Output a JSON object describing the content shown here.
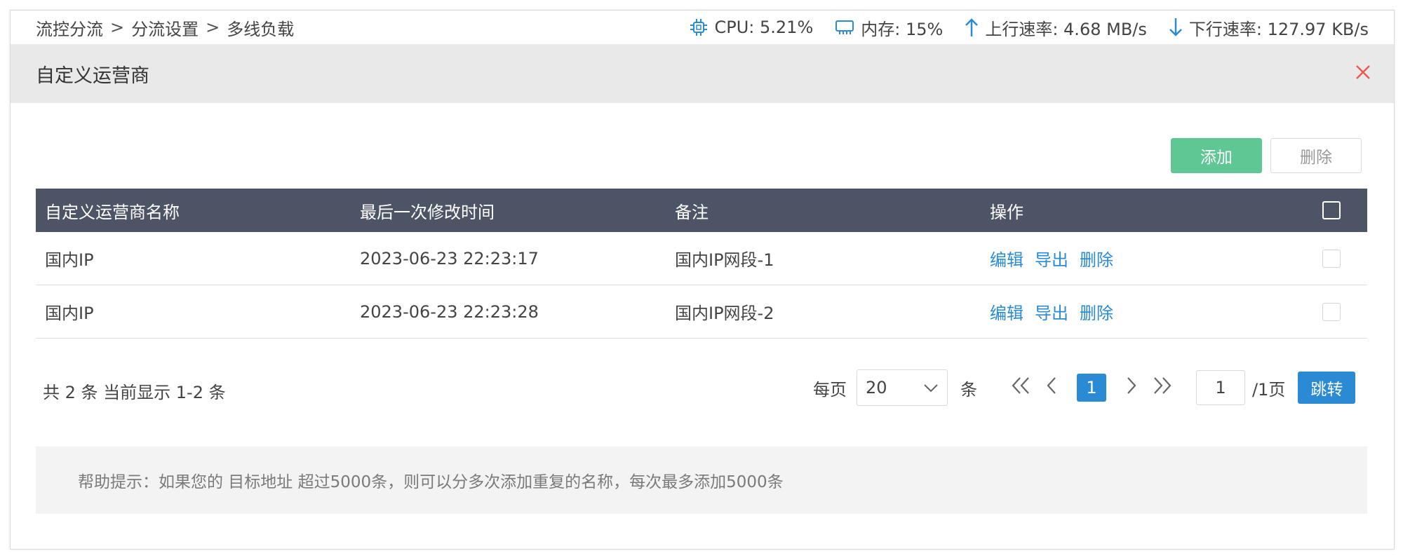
{
  "breadcrumb": {
    "items": [
      "流控分流",
      "分流设置",
      "多线负载"
    ],
    "separator": ">"
  },
  "status": {
    "cpu": "CPU: 5.21%",
    "memory": "内存: 15%",
    "upload": "上行速率: 4.68 MB/s",
    "download": "下行速率: 127.97 KB/s"
  },
  "dialog": {
    "title": "自定义运营商"
  },
  "actions": {
    "add_label": "添加",
    "delete_label": "删除"
  },
  "table": {
    "headers": [
      "自定义运营商名称",
      "最后一次修改时间",
      "备注",
      "操作"
    ],
    "rows": [
      {
        "name": "国内IP",
        "modified": "2023-06-23 22:23:17",
        "note": "国内IP网段-1",
        "op_edit": "编辑",
        "op_export": "导出",
        "op_delete": "删除"
      },
      {
        "name": "国内IP",
        "modified": "2023-06-23 22:23:28",
        "note": "国内IP网段-2",
        "op_edit": "编辑",
        "op_export": "导出",
        "op_delete": "删除"
      }
    ]
  },
  "pagination": {
    "summary": "共 2 条 当前显示 1-2 条",
    "per_page_label": "每页",
    "per_page_value": "20",
    "per_page_unit": "条",
    "current_page": "1",
    "page_input": "1",
    "total_pages": "/1页",
    "jump_label": "跳转"
  },
  "help": {
    "text": "帮助提示：如果您的 目标地址 超过5000条，则可以分多次添加重复的名称，每次最多添加5000条"
  },
  "colors": {
    "accent_blue": "#2a8ad4",
    "add_green": "#5ec794",
    "header_dark": "#4d5466",
    "close_red": "#e85a4f"
  }
}
